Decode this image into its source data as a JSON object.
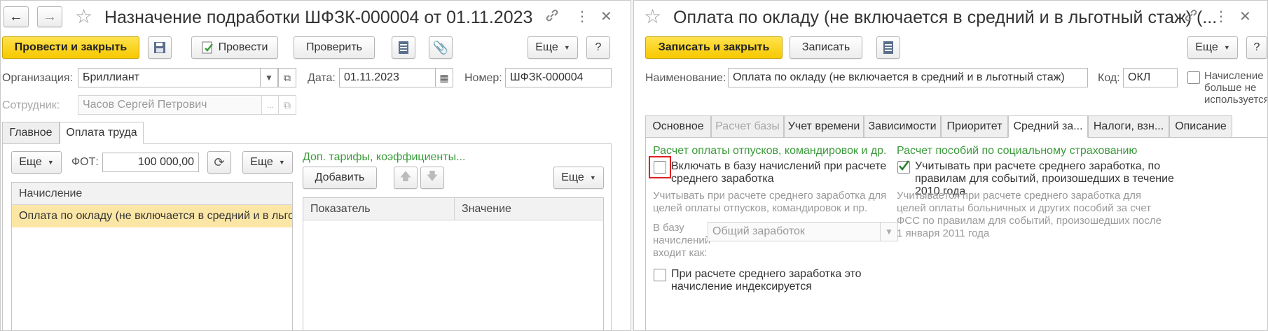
{
  "left": {
    "title": "Назначение подработки ШФЗК-000004 от 01.11.2023",
    "toolbar": {
      "post_close": "Провести и закрыть",
      "post": "Провести",
      "check": "Проверить",
      "more": "Еще",
      "help": "?"
    },
    "org_label": "Организация:",
    "org_value": "Бриллиант",
    "date_label": "Дата:",
    "date_value": "01.11.2023",
    "number_label": "Номер:",
    "number_value": "ШФЗК-000004",
    "employee_label": "Сотрудник:",
    "employee_value": "Часов Сергей Петрович",
    "tabs": [
      "Главное",
      "Оплата труда"
    ],
    "pay": {
      "more": "Еще",
      "fot_label": "ФОТ:",
      "fot_value": "100 000,00",
      "more2": "Еще",
      "grid_header": "Начисление",
      "grid_row": "Оплата по окладу (не включается в средний и в льготный стаж)"
    },
    "extra": {
      "link": "Доп. тарифы, коэффициенты...",
      "add": "Добавить",
      "more": "Еще",
      "col1": "Показатель",
      "col2": "Значение"
    }
  },
  "right": {
    "title": "Оплата по окладу (не включается в средний и в льготный стаж) (...",
    "toolbar": {
      "save_close": "Записать и закрыть",
      "save": "Записать",
      "more": "Еще",
      "help": "?"
    },
    "name_label": "Наименование:",
    "name_value": "Оплата по окладу (не включается в средний и в льготный стаж)",
    "code_label": "Код:",
    "code_value": "ОКЛ",
    "unused_label": "Начисление больше не используется",
    "tabs": [
      "Основное",
      "Расчет базы",
      "Учет времени",
      "Зависимости",
      "Приоритет",
      "Средний за...",
      "Налоги, взн...",
      "Описание"
    ],
    "avg": {
      "vac_header": "Расчет оплаты отпусков, командировок и др.",
      "include_check": "Включать в базу начислений при расчете среднего заработка",
      "include_hint": "Учитывать при расчете среднего заработка для целей оплаты отпусков, командировок и пр.",
      "base_label": "В базу начислений входит как:",
      "base_value": "Общий заработок",
      "index_check": "При расчете среднего заработка это начисление индексируется",
      "soc_header": "Расчет пособий по социальному страхованию",
      "soc_check": "Учитывать при расчете среднего заработка, по правилам для событий, произошедших в течение 2010 года",
      "soc_hint": "Учитывается при расчете среднего заработка для целей оплаты больничных и других пособий за счет ФСС по правилам для событий, произошедших после 1 января 2011 года"
    }
  }
}
